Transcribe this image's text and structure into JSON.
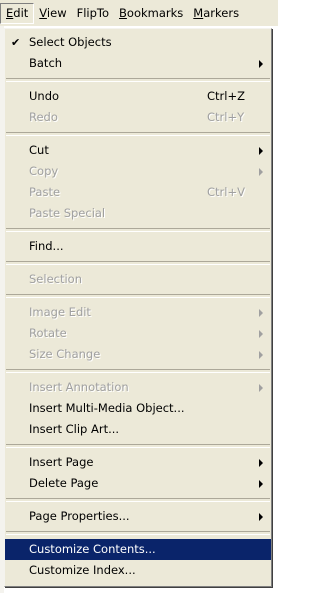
{
  "menubar": {
    "items": [
      {
        "text": "Edit",
        "key": "E",
        "rest": "dit"
      },
      {
        "text": "View",
        "key": "V",
        "rest": "iew"
      },
      {
        "text": "FlipTo",
        "key": "",
        "rest": "FlipTo"
      },
      {
        "text": "Bookmarks",
        "key": "B",
        "rest": "ookmarks"
      },
      {
        "text": "Markers",
        "key": "M",
        "rest": "arkers"
      }
    ]
  },
  "menu": {
    "check_glyph": "✔",
    "items": [
      {
        "label": "Select Objects",
        "checked": true
      },
      {
        "label": "Batch",
        "submenu": true
      },
      {
        "label": "Undo",
        "shortcut": "Ctrl+Z"
      },
      {
        "label": "Redo",
        "shortcut": "Ctrl+Y",
        "disabled": true
      },
      {
        "label": "Cut",
        "submenu": true
      },
      {
        "label": "Copy",
        "submenu": true,
        "disabled": true
      },
      {
        "label": "Paste",
        "shortcut": "Ctrl+V",
        "disabled": true
      },
      {
        "label": "Paste Special",
        "disabled": true
      },
      {
        "label": "Find..."
      },
      {
        "label": "Selection",
        "disabled": true
      },
      {
        "label": "Image Edit",
        "submenu": true,
        "disabled": true
      },
      {
        "label": "Rotate",
        "submenu": true,
        "disabled": true
      },
      {
        "label": "Size Change",
        "submenu": true,
        "disabled": true
      },
      {
        "label": "Insert Annotation",
        "submenu": true,
        "disabled": true
      },
      {
        "label": "Insert Multi-Media Object..."
      },
      {
        "label": "Insert Clip Art..."
      },
      {
        "label": "Insert Page",
        "submenu": true
      },
      {
        "label": "Delete Page",
        "submenu": true
      },
      {
        "label": "Page Properties...",
        "submenu": true
      },
      {
        "label": "Customize Contents...",
        "highlighted": true
      },
      {
        "label": "Customize Index..."
      }
    ]
  },
  "colors": {
    "menu_bg": "#ece9d8",
    "highlight": "#0a246a",
    "disabled_text": "#a0a0a0"
  }
}
